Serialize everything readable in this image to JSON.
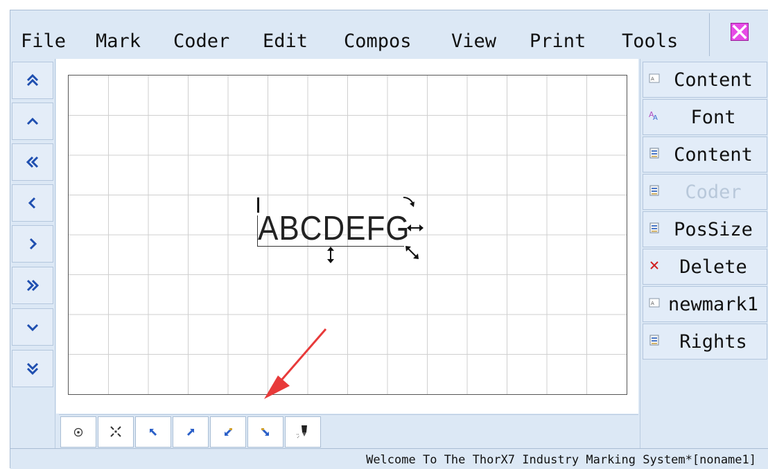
{
  "menu": [
    "File",
    "Mark",
    "Coder",
    "Edit",
    "Compos",
    "View",
    "Print",
    "Tools"
  ],
  "left_nav": [
    {
      "icon": "double-chevron-up-icon"
    },
    {
      "icon": "chevron-up-icon"
    },
    {
      "icon": "double-chevron-left-icon"
    },
    {
      "icon": "chevron-left-icon"
    },
    {
      "icon": "chevron-right-icon"
    },
    {
      "icon": "double-chevron-right-icon"
    },
    {
      "icon": "chevron-down-icon"
    },
    {
      "icon": "double-chevron-down-icon"
    }
  ],
  "canvas": {
    "text": "ABCDEFG",
    "grid_color": "#cfcfcf",
    "text_color": "#222222"
  },
  "right_panel": [
    {
      "label": "Content",
      "icon": "text-field-icon",
      "enabled": true
    },
    {
      "label": "Font",
      "icon": "font-icon",
      "enabled": true
    },
    {
      "label": "Content",
      "icon": "document-icon",
      "enabled": true
    },
    {
      "label": "Coder",
      "icon": "document-icon",
      "enabled": false
    },
    {
      "label": "PosSize",
      "icon": "document-icon",
      "enabled": true
    },
    {
      "label": "Delete",
      "icon": "delete-x-icon",
      "enabled": true
    },
    {
      "label": "newmark1",
      "icon": "text-field-icon",
      "enabled": true
    },
    {
      "label": "Rights",
      "icon": "document-icon",
      "enabled": true
    }
  ],
  "bottom_toolbar": [
    {
      "icon": "center-dot-icon"
    },
    {
      "icon": "spread-arrows-icon"
    },
    {
      "icon": "align-top-left-icon"
    },
    {
      "icon": "align-top-right-icon"
    },
    {
      "icon": "align-bottom-left-icon"
    },
    {
      "icon": "align-bottom-right-icon"
    },
    {
      "icon": "marker-pen-icon"
    }
  ],
  "status": "Welcome To The ThorX7 Industry Marking System*[noname1]",
  "colors": {
    "window_bg": "#dce8f5",
    "button_bg": "#e2ecf8",
    "accent": "#1f4fb0",
    "close_bg": "#e64be6",
    "disabled_text": "#b8c8da",
    "annotation_arrow": "#e83a3a"
  }
}
